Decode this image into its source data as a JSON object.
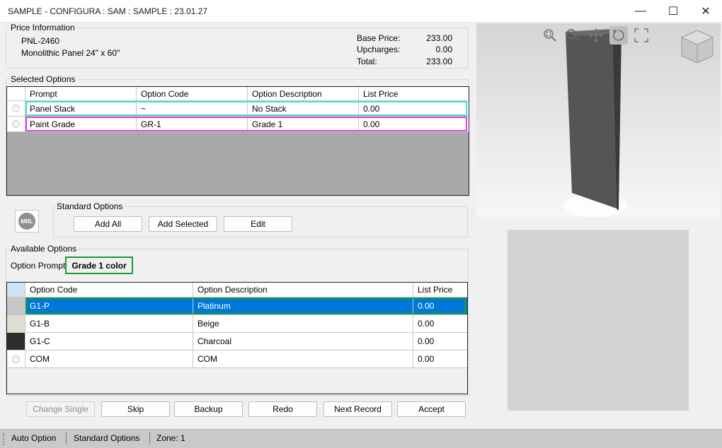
{
  "window": {
    "title": "SAMPLE - CONFIGURA : SAM : SAMPLE : 23.01.27",
    "controls": {
      "minimize": "—",
      "maximize": "☐",
      "close": "✕"
    }
  },
  "price_info": {
    "label": "Price Information",
    "part_number": "PNL-2460",
    "description": "Monolithic Panel 24\" x 60\"",
    "base_price_label": "Base Price:",
    "base_price": "233.00",
    "upcharges_label": "Upcharges:",
    "upcharges": "0.00",
    "total_label": "Total:",
    "total": "233.00"
  },
  "selected_options": {
    "label": "Selected Options",
    "columns": [
      "Prompt",
      "Option Code",
      "Option Description",
      "List Price"
    ],
    "rows": [
      {
        "prompt": "Panel Stack",
        "code": "~",
        "description": "No Stack",
        "price": "0.00",
        "highlight": "#40e0d0"
      },
      {
        "prompt": "Paint Grade",
        "code": "GR-1",
        "description": "Grade 1",
        "price": "0.00",
        "highlight": "#e040e0"
      }
    ]
  },
  "standard_options": {
    "label": "Standard Options",
    "logo_text": "MRL",
    "add_all": "Add All",
    "add_selected": "Add Selected",
    "edit": "Edit"
  },
  "available_options": {
    "label": "Available Options",
    "prompt_label": "Option Prompt:",
    "prompt_value": "Grade 1 color",
    "columns": [
      "Option Code",
      "Option Description",
      "List Price"
    ],
    "rows": [
      {
        "code": "G1-P",
        "description": "Platinum",
        "price": "0.00",
        "swatch": "#c8c8c8",
        "selected": true
      },
      {
        "code": "G1-B",
        "description": "Beige",
        "price": "0.00",
        "swatch": "#e0ddd0",
        "selected": false
      },
      {
        "code": "G1-C",
        "description": "Charcoal",
        "price": "0.00",
        "swatch": "#2d2c2e",
        "selected": false
      },
      {
        "code": "COM",
        "description": "COM",
        "price": "0.00",
        "swatch": "icon",
        "selected": false
      }
    ]
  },
  "actions": {
    "change_single": "Change Single",
    "skip": "Skip",
    "backup": "Backup",
    "redo": "Redo",
    "next_record": "Next Record",
    "accept": "Accept"
  },
  "status": {
    "mode": "Auto Option",
    "section": "Standard Options",
    "zone": "Zone: 1"
  },
  "colors": {
    "selection": "#0078d7",
    "highlight_green": "#1f9a3a",
    "highlight_cyan": "#40e0d0",
    "highlight_magenta": "#e040e0"
  }
}
